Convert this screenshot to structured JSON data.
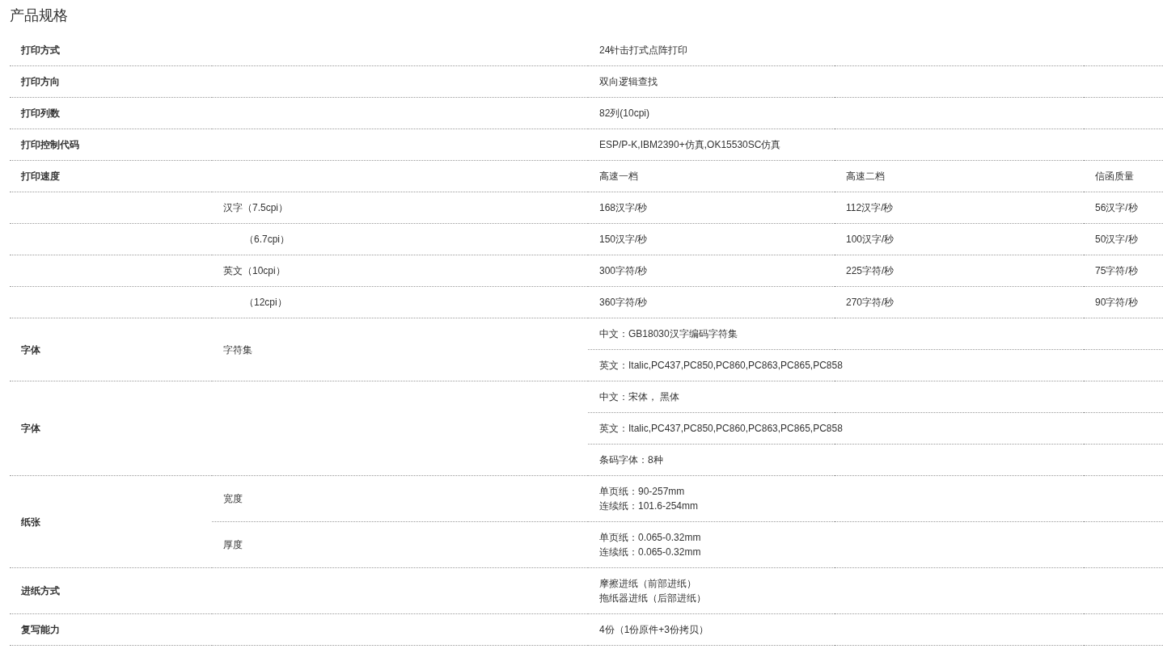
{
  "title": "产品规格",
  "sections": [
    {
      "kind": "simple",
      "label": "打印方式",
      "value": "24针击打式点阵打印"
    },
    {
      "kind": "simple",
      "label": "打印方向",
      "value": "双向逻辑查找"
    },
    {
      "kind": "simple",
      "label": "打印列数",
      "value": "82列(10cpi)"
    },
    {
      "kind": "simple",
      "label": "打印控制代码",
      "value": "ESP/P-K,IBM2390+仿真,OK15530SC仿真"
    },
    {
      "kind": "speed",
      "label": "打印速度",
      "headers": [
        "高速一档",
        "高速二档",
        "信函质量"
      ],
      "groups": [
        {
          "rows": [
            {
              "label": "汉字（7.5cpi）",
              "values": [
                "168汉字/秒",
                "112汉字/秒",
                "56汉字/秒"
              ]
            },
            {
              "label": "（6.7cpi）",
              "values": [
                "150汉字/秒",
                "100汉字/秒",
                "50汉字/秒"
              ]
            }
          ]
        },
        {
          "rows": [
            {
              "label": "英文（10cpi）",
              "values": [
                "300字符/秒",
                "225字符/秒",
                "75字符/秒"
              ]
            },
            {
              "label": "（12cpi）",
              "values": [
                "360字符/秒",
                "270字符/秒",
                "90字符/秒"
              ]
            }
          ]
        }
      ]
    },
    {
      "kind": "group",
      "label": "字体",
      "items": [
        {
          "label": "字符集",
          "values": [
            "中文：GB18030汉字编码字符集",
            "英文：Italic,PC437,PC850,PC860,PC863,PC865,PC858"
          ]
        }
      ]
    },
    {
      "kind": "group",
      "label": "字体",
      "items": [
        {
          "values": [
            "中文：宋体， 黑体",
            "英文：Italic,PC437,PC850,PC860,PC863,PC865,PC858",
            "条码字体：8种"
          ]
        }
      ]
    },
    {
      "kind": "group",
      "label": "纸张",
      "items": [
        {
          "label": "宽度",
          "values": [
            [
              "单页纸：90-257mm",
              "连续纸：101.6-254mm"
            ]
          ]
        },
        {
          "label": "厚度",
          "values": [
            [
              "单页纸：0.065-0.32mm",
              "连续纸：0.065-0.32mm"
            ]
          ]
        }
      ]
    },
    {
      "kind": "simple",
      "label": "进纸方式",
      "value": [
        "摩擦进纸（前部进纸）",
        "拖纸器进纸（后部进纸）"
      ]
    },
    {
      "kind": "simple",
      "label": "复写能力",
      "value": "4份（1份原件+3份拷贝）"
    }
  ]
}
